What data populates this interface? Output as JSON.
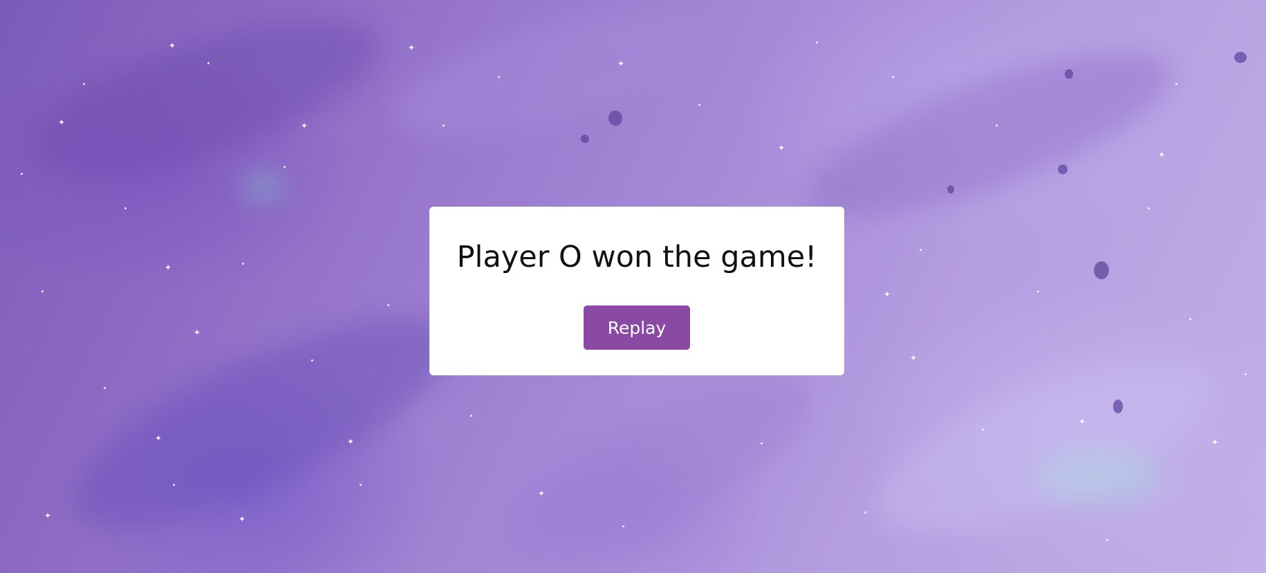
{
  "theme": {
    "button_color": "#8a4aa3",
    "modal_background": "#ffffff",
    "text_color": "#111111"
  },
  "modal": {
    "message": "Player O won the game!",
    "replay_label": "Replay"
  }
}
